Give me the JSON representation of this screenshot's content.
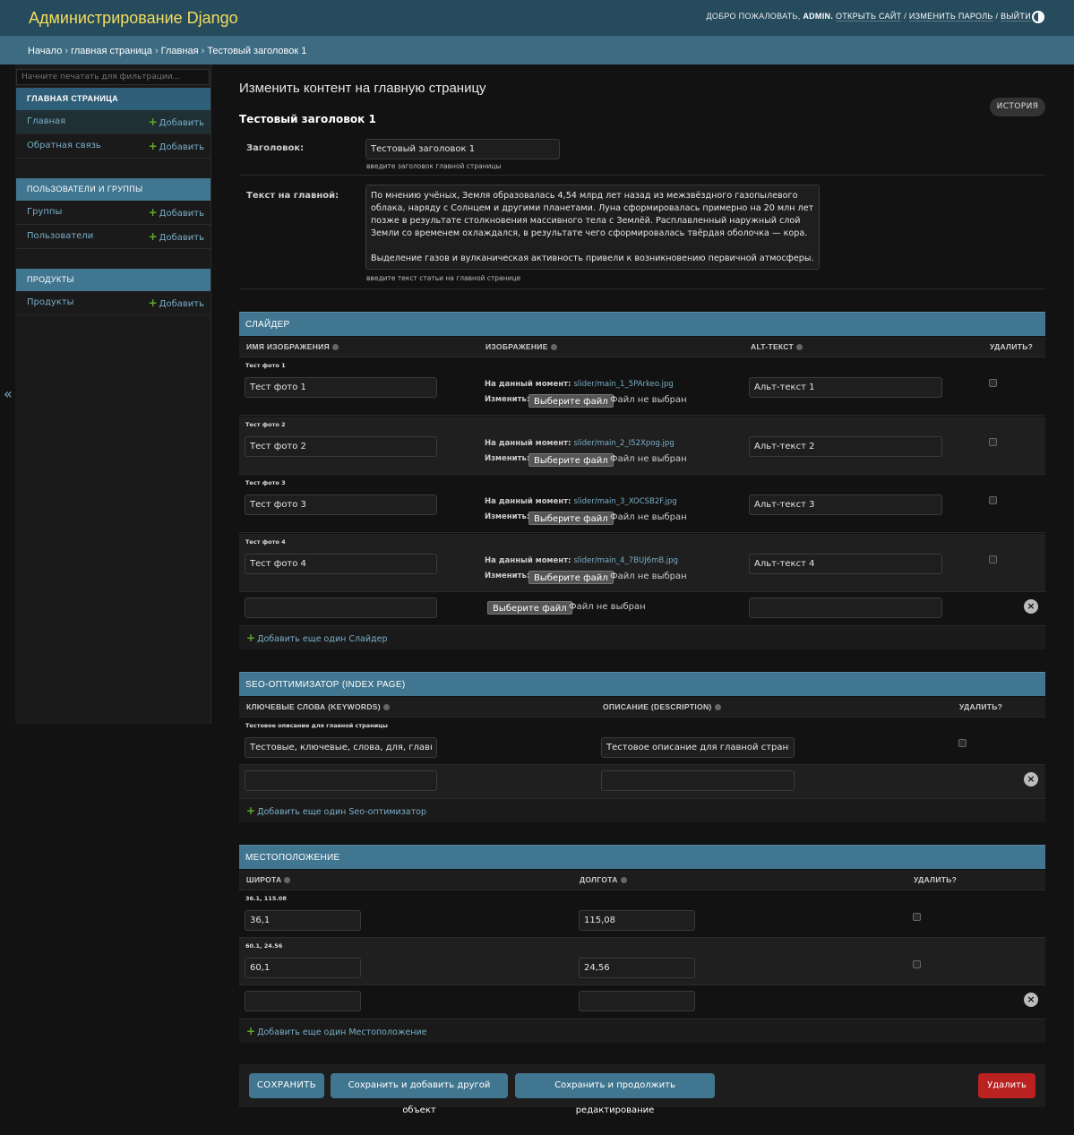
{
  "header": {
    "branding": "Администрирование Django",
    "welcome": "Добро пожаловать,",
    "username": "admin.",
    "view_site": "Открыть сайт",
    "change_password": "Изменить пароль",
    "logout": "Выйти",
    "sep": "/"
  },
  "breadcrumbs": [
    "Начало",
    "главная страница",
    "Главная",
    "Тестовый заголовок 1"
  ],
  "sidebar": {
    "filter_placeholder": "Начните печатать для фильтрации...",
    "add_label": "Добавить",
    "modules": [
      {
        "caption": "Главная страница",
        "items": [
          "Главная",
          "Обратная связь"
        ]
      },
      {
        "caption": "Пользователи и группы",
        "items": [
          "Группы",
          "Пользователи"
        ]
      },
      {
        "caption": "Продукты",
        "items": [
          "Продукты"
        ]
      }
    ],
    "collapse": "«"
  },
  "content": {
    "title": "Изменить контент на главную страницу",
    "object_title": "Тестовый заголовок 1",
    "history": "История",
    "heading_label": "Заголовок:",
    "heading_value": "Тестовый заголовок 1",
    "heading_help": "введите заголовок главной страницы",
    "text_label": "Текст на главной:",
    "text_value": "По мнению учёных, Земля образовалась 4,54 млрд лет назад из межзвёздного газопылевого облака, наряду с Солнцем и другими планетами. Луна сформировалась примерно на 20 млн лет позже в результате столкновения массивного тела с Землёй. Расплавленный наружный слой Земли со временем охлаждался, в результате чего сформировалась твёрдая оболочка — кора.\n\nВыделение газов и вулканическая активность привели к возникновению первичной атмосферы.",
    "text_help": "введите текст статьи на главной странице"
  },
  "slider": {
    "title": "Слайдер",
    "columns": [
      "Имя изображения",
      "Изображение",
      "Alt-текст",
      "Удалить?"
    ],
    "current_label": "На данный момент:",
    "change_label": "Изменить:",
    "choose_file": "Выберите файл",
    "no_file": "Файл не выбран",
    "rows": [
      {
        "object": "Тест фото 1",
        "name": "Тест фото 1",
        "file": "slider/main_1_5PArkeo.jpg",
        "alt": "Альт-текст 1"
      },
      {
        "object": "Тест фото 2",
        "name": "Тест фото 2",
        "file": "slider/main_2_I52Xpog.jpg",
        "alt": "Альт-текст 2"
      },
      {
        "object": "Тест фото 3",
        "name": "Тест фото 3",
        "file": "slider/main_3_XOCSB2F.jpg",
        "alt": "Альт-текст 3"
      },
      {
        "object": "Тест фото 4",
        "name": "Тест фото 4",
        "file": "slider/main_4_7BUJ6mB.jpg",
        "alt": "Альт-текст 4"
      }
    ],
    "add_another": "Добавить еще один Слайдер"
  },
  "seo": {
    "title": "Seo-оптимизатор (index page)",
    "columns": [
      "Ключевые слова (keywords)",
      "Описание (description)",
      "Удалить?"
    ],
    "rows": [
      {
        "object": "Тестовое описание для главной страницы",
        "keywords": "Тестовые, ключевые, слова, для, главной, страницы",
        "description": "Тестовое описание для главной страницы"
      }
    ],
    "add_another": "Добавить еще один Seo-оптимизатор"
  },
  "location": {
    "title": "Местоположение",
    "columns": [
      "Широта",
      "Долгота",
      "Удалить?"
    ],
    "rows": [
      {
        "object": "36.1, 115.08",
        "lat": "36,1",
        "lon": "115,08"
      },
      {
        "object": "60.1, 24.56",
        "lat": "60,1",
        "lon": "24,56"
      }
    ],
    "add_another": "Добавить еще один Местоположение"
  },
  "submit": {
    "save": "Сохранить",
    "save_add": "Сохранить и добавить другой объект",
    "save_continue": "Сохранить и продолжить редактирование",
    "delete": "Удалить"
  },
  "colors": {
    "header_bg": "#264b5d",
    "breadcrumbs_bg": "#3d6b82",
    "module_caption": "#417690",
    "branding": "#f5dd5d",
    "link": "#79aec8",
    "delete": "#ba2121"
  }
}
